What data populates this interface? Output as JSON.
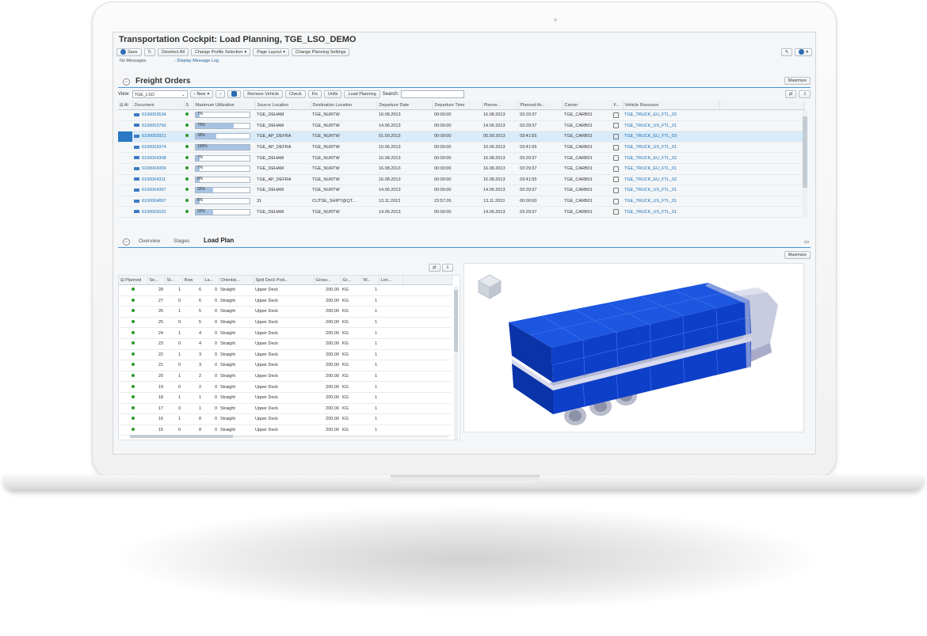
{
  "window": {
    "title": "Transportation Cockpit: Load Planning, TGE_LSO_DEMO"
  },
  "toolbar": {
    "save": "Save",
    "deselect_all": "Deselect All",
    "change_profile": "Change Profile Selection",
    "page_layout": "Page Layout",
    "change_planning": "Change Planning Settings"
  },
  "messages": {
    "status": "No Messages",
    "link": "- Display Message Log"
  },
  "freight_orders": {
    "title": "Freight Orders",
    "maximize": "Maximize",
    "view_label": "View:",
    "view_value": "TGE_LSO",
    "new_label": "New",
    "remove_vehicle": "Remove Vehicle",
    "check": "Check",
    "fix": "Fix",
    "unfix": "Unfix",
    "load_planning": "Load Planning",
    "search_label": "Search:",
    "columns": [
      "Document",
      "S",
      "Maximum Utilization",
      "Source Location",
      "Destination Location",
      "Departure Date",
      "Departure Time",
      "Planne...",
      "Planned Ar...",
      "Carrier",
      "F...",
      "Vehicle Resource"
    ],
    "rows": [
      {
        "doc": "6100003534",
        "util": "7%",
        "util_frac": 0.07,
        "src": "TGE_DEHAM",
        "dst": "TGE_NURTW",
        "dep_date": "16.08.2013",
        "dep_time": "00:00:00",
        "plan_date": "16.08.2013",
        "plan_time": "03:29:37",
        "carrier": "TGE_CARB01",
        "vehicle": "TGE_TRUCK_EU_FTL_02"
      },
      {
        "doc": "6100003760",
        "util": "70%",
        "util_frac": 0.7,
        "src": "TGE_DEHAM",
        "dst": "TGE_NURTW",
        "dep_date": "14.06.2013",
        "dep_time": "00:00:00",
        "plan_date": "14.06.2013",
        "plan_time": "03:29:37",
        "carrier": "TGE_CARB01",
        "vehicle": "TGE_TRUCK_US_FTL_01"
      },
      {
        "doc": "6100003921",
        "util": "38%",
        "util_frac": 0.38,
        "src": "TGE_AP_DEFRA",
        "dst": "TGE_NURTW",
        "dep_date": "01.09.2013",
        "dep_time": "00:00:00",
        "plan_date": "05.09.2013",
        "plan_time": "03:41:55",
        "carrier": "TGE_CARB01",
        "vehicle": "TGE_TRUCK_EU_FTL_03"
      },
      {
        "doc": "6100003374",
        "util": "100%",
        "util_frac": 1.0,
        "src": "TGE_AP_DEFRA",
        "dst": "TGE_NURTW",
        "dep_date": "10.06.2013",
        "dep_time": "00:00:00",
        "plan_date": "10.06.2013",
        "plan_time": "03:41:55",
        "carrier": "TGE_CARB01",
        "vehicle": "TGE_TRUCK_US_FTL_01"
      },
      {
        "doc": "6100004308",
        "util": "7%",
        "util_frac": 0.07,
        "src": "TGE_DEHAM",
        "dst": "TGE_NURTW",
        "dep_date": "16.08.2013",
        "dep_time": "00:00:00",
        "plan_date": "16.08.2013",
        "plan_time": "03:29:37",
        "carrier": "TGE_CARB01",
        "vehicle": "TGE_TRUCK_EU_FTL_02"
      },
      {
        "doc": "6100004309",
        "util": "7%",
        "util_frac": 0.07,
        "src": "TGE_DEHAM",
        "dst": "TGE_NURTW",
        "dep_date": "16.08.2013",
        "dep_time": "00:00:00",
        "plan_date": "16.08.2013",
        "plan_time": "03:29:37",
        "carrier": "TGE_CARB01",
        "vehicle": "TGE_TRUCK_EU_FTL_01"
      },
      {
        "doc": "6100004311",
        "util": "8%",
        "util_frac": 0.08,
        "src": "TGE_AP_DEFRA",
        "dst": "TGE_NURTW",
        "dep_date": "16.08.2013",
        "dep_time": "00:00:00",
        "plan_date": "16.08.2013",
        "plan_time": "03:41:55",
        "carrier": "TGE_CARB01",
        "vehicle": "TGE_TRUCK_EU_FTL_02"
      },
      {
        "doc": "6100004367",
        "util": "32%",
        "util_frac": 0.32,
        "src": "TGE_DEHAM",
        "dst": "TGE_NURTW",
        "dep_date": "14.06.2013",
        "dep_time": "00:00:00",
        "plan_date": "14.06.2013",
        "plan_time": "03:29:37",
        "carrier": "TGE_CARB01",
        "vehicle": "TGE_TRUCK_US_FTL_01"
      },
      {
        "doc": "6100004897",
        "util": "8%",
        "util_frac": 0.08,
        "src": "31",
        "dst": "CUTSE_SHIPT@QT...",
        "dep_date": "13.11.2013",
        "dep_time": "23:57:26",
        "plan_date": "13.11.2013",
        "plan_time": "00:00:00",
        "carrier": "TGE_CARB01",
        "vehicle": "TGE_TRUCK_US_FTL_01"
      },
      {
        "doc": "6100005022",
        "util": "32%",
        "util_frac": 0.32,
        "src": "TGE_DEHAM",
        "dst": "TGE_NURTW",
        "dep_date": "14.06.2013",
        "dep_time": "00:00:00",
        "plan_date": "14.06.2013",
        "plan_time": "03:29:37",
        "carrier": "TGE_CARB01",
        "vehicle": "TGE_TRUCK_US_FTL_01"
      }
    ]
  },
  "load_plan": {
    "tabs": [
      "Overview",
      "Stages",
      "Load Plan"
    ],
    "maximize": "Maximize",
    "columns": [
      "Planned",
      "Se...",
      "St...",
      "Row",
      "La...",
      "Orientat...",
      "Split Deck Posi...",
      "Gross...",
      "Gr...",
      "W...",
      "Len..."
    ],
    "rows": [
      {
        "seq": "28",
        "st": "1",
        "row": "6",
        "la": "0",
        "orient": "Straight",
        "deck": "Upper Deck",
        "gross": "200,00",
        "unit": "KG",
        "w": "1"
      },
      {
        "seq": "27",
        "st": "0",
        "row": "6",
        "la": "0",
        "orient": "Straight",
        "deck": "Upper Deck",
        "gross": "200,00",
        "unit": "KG",
        "w": "1"
      },
      {
        "seq": "26",
        "st": "1",
        "row": "5",
        "la": "0",
        "orient": "Straight",
        "deck": "Upper Deck",
        "gross": "200,00",
        "unit": "KG",
        "w": "1"
      },
      {
        "seq": "25",
        "st": "0",
        "row": "5",
        "la": "0",
        "orient": "Straight",
        "deck": "Upper Deck",
        "gross": "200,00",
        "unit": "KG",
        "w": "1"
      },
      {
        "seq": "24",
        "st": "1",
        "row": "4",
        "la": "0",
        "orient": "Straight",
        "deck": "Upper Deck",
        "gross": "200,00",
        "unit": "KG",
        "w": "1"
      },
      {
        "seq": "23",
        "st": "0",
        "row": "4",
        "la": "0",
        "orient": "Straight",
        "deck": "Upper Deck",
        "gross": "200,00",
        "unit": "KG",
        "w": "1"
      },
      {
        "seq": "22",
        "st": "1",
        "row": "3",
        "la": "0",
        "orient": "Straight",
        "deck": "Upper Deck",
        "gross": "200,00",
        "unit": "KG",
        "w": "1"
      },
      {
        "seq": "21",
        "st": "0",
        "row": "3",
        "la": "0",
        "orient": "Straight",
        "deck": "Upper Deck",
        "gross": "200,00",
        "unit": "KG",
        "w": "1"
      },
      {
        "seq": "20",
        "st": "1",
        "row": "2",
        "la": "0",
        "orient": "Straight",
        "deck": "Upper Deck",
        "gross": "200,00",
        "unit": "KG",
        "w": "1"
      },
      {
        "seq": "19",
        "st": "0",
        "row": "2",
        "la": "0",
        "orient": "Straight",
        "deck": "Upper Deck",
        "gross": "200,00",
        "unit": "KG",
        "w": "1"
      },
      {
        "seq": "18",
        "st": "1",
        "row": "1",
        "la": "0",
        "orient": "Straight",
        "deck": "Upper Deck",
        "gross": "200,00",
        "unit": "KG",
        "w": "1"
      },
      {
        "seq": "17",
        "st": "0",
        "row": "1",
        "la": "0",
        "orient": "Straight",
        "deck": "Upper Deck",
        "gross": "200,00",
        "unit": "KG",
        "w": "1"
      },
      {
        "seq": "16",
        "st": "1",
        "row": "8",
        "la": "0",
        "orient": "Straight",
        "deck": "Upper Deck",
        "gross": "200,00",
        "unit": "KG",
        "w": "1"
      },
      {
        "seq": "15",
        "st": "0",
        "row": "8",
        "la": "0",
        "orient": "Straight",
        "deck": "Upper Deck",
        "gross": "200,00",
        "unit": "KG",
        "w": "1"
      }
    ]
  }
}
